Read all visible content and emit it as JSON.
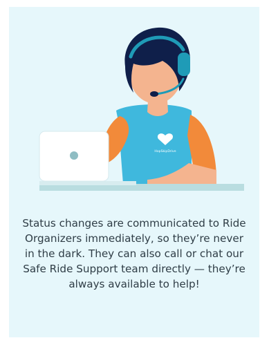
{
  "illustration": {
    "subject": "support-agent-with-headset-at-laptop",
    "shirt_logo_text": "HopSkipDrive",
    "colors": {
      "card_background": "#e6f7fb",
      "shirt": "#3fb8dd",
      "hair": "#0f1f4a",
      "skin": "#f4b48f",
      "sleeves": "#f28a3a",
      "headset": "#1f9bb7",
      "laptop": "#ffffff",
      "desk": "#b9dde0"
    }
  },
  "caption": {
    "text": "Status changes are communicated to Ride Organizers immediately, so they’re never in the dark. They can also call or chat our Safe Ride Support team directly — they’re always available to help!"
  }
}
